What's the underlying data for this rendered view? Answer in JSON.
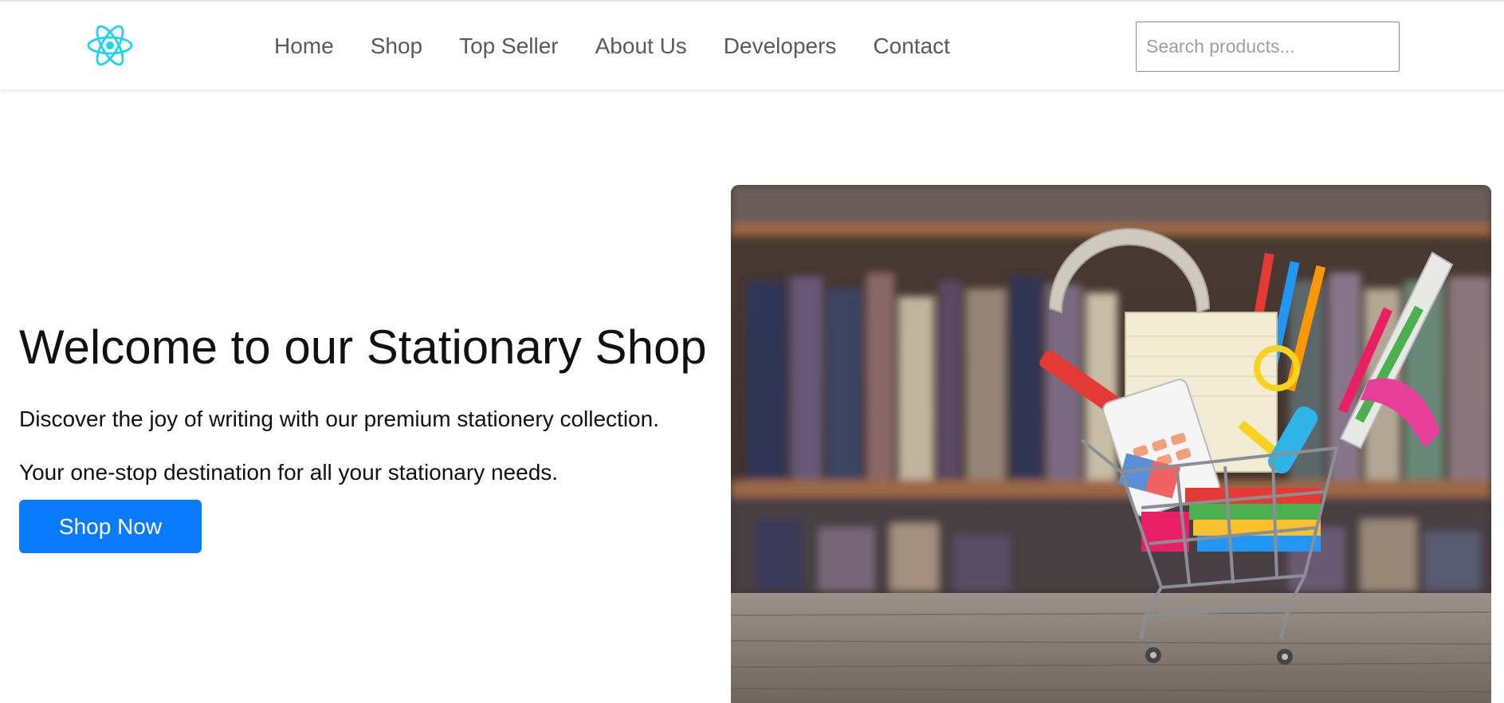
{
  "nav": {
    "logo": "react-atom-logo",
    "links": [
      "Home",
      "Shop",
      "Top Seller",
      "About Us",
      "Developers",
      "Contact"
    ],
    "search_placeholder": "Search products..."
  },
  "hero": {
    "title": "Welcome to our Stationary Shop",
    "subtitle1": "Discover the joy of writing with our premium stationery collection.",
    "subtitle2": "Your one-stop destination for all your stationary needs.",
    "cta_label": "Shop Now",
    "image": "stationery-cart-bookshelf-photo"
  },
  "colors": {
    "logo": "#22d3ee",
    "cta": "#0a7bfd",
    "nav_text": "#5a5a5a"
  }
}
